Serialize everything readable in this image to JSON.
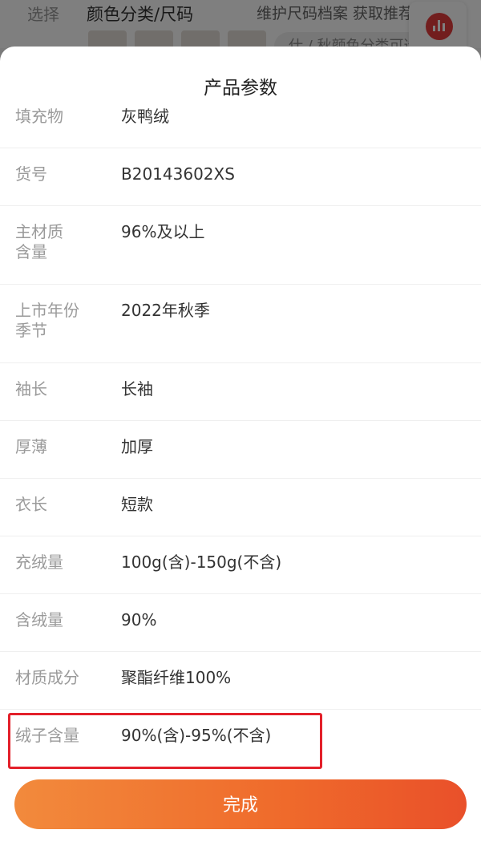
{
  "background": {
    "label": "选择",
    "title": "颜色分类/尺码",
    "right_text": "维护尺码档案 获取推荐",
    "chip_text": "仕 / 秋颜色分类可选"
  },
  "sheet": {
    "title": "产品参数",
    "rows": [
      {
        "label": "填充物",
        "value": "灰鸭绒"
      },
      {
        "label": "货号",
        "value": "B20143602XS"
      },
      {
        "label": "主材质\n含量",
        "value": "96%及以上"
      },
      {
        "label": "上市年份\n季节",
        "value": "2022年秋季"
      },
      {
        "label": "袖长",
        "value": "长袖"
      },
      {
        "label": "厚薄",
        "value": "加厚"
      },
      {
        "label": "衣长",
        "value": "短款"
      },
      {
        "label": "充绒量",
        "value": "100g(含)-150g(不含)"
      },
      {
        "label": "含绒量",
        "value": "90%"
      },
      {
        "label": "材质成分",
        "value": "聚酯纤维100%"
      },
      {
        "label": "绒子含量",
        "value": "90%(含)-95%(不含)"
      }
    ],
    "done_label": "完成"
  },
  "colors": {
    "highlight": "#e3202a",
    "button_start": "#f28a3c",
    "button_end": "#e9502a"
  },
  "icons": {
    "stats": "bar-chart-icon"
  }
}
